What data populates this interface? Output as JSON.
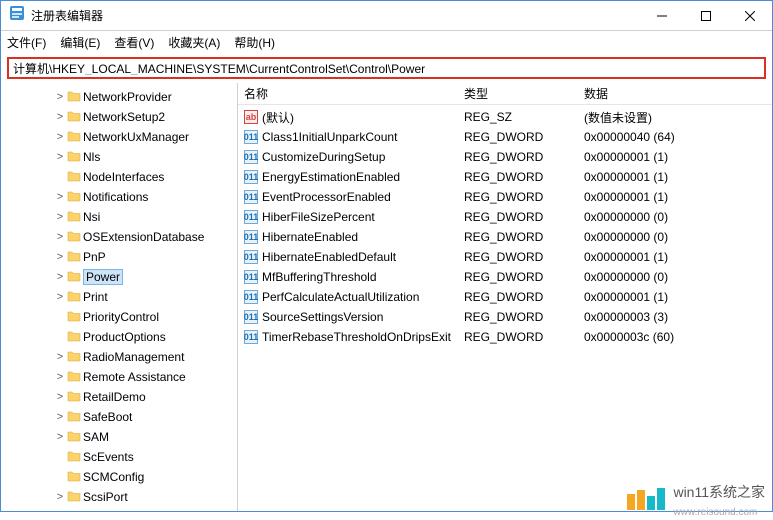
{
  "window": {
    "title": "注册表编辑器"
  },
  "menu": {
    "file": "文件(F)",
    "edit": "编辑(E)",
    "view": "查看(V)",
    "fav": "收藏夹(A)",
    "help": "帮助(H)"
  },
  "address": "计算机\\HKEY_LOCAL_MACHINE\\SYSTEM\\CurrentControlSet\\Control\\Power",
  "tree": [
    {
      "indent": 3,
      "tw": ">",
      "cv": "",
      "label": "NetworkProvider"
    },
    {
      "indent": 3,
      "tw": ">",
      "cv": "",
      "label": "NetworkSetup2"
    },
    {
      "indent": 3,
      "tw": ">",
      "cv": "",
      "label": "NetworkUxManager"
    },
    {
      "indent": 3,
      "tw": ">",
      "cv": "",
      "label": "Nls"
    },
    {
      "indent": 3,
      "tw": "",
      "cv": "",
      "label": "NodeInterfaces"
    },
    {
      "indent": 3,
      "tw": ">",
      "cv": "",
      "label": "Notifications"
    },
    {
      "indent": 3,
      "tw": ">",
      "cv": "",
      "label": "Nsi"
    },
    {
      "indent": 3,
      "tw": ">",
      "cv": "",
      "label": "OSExtensionDatabase"
    },
    {
      "indent": 3,
      "tw": ">",
      "cv": "",
      "label": "PnP"
    },
    {
      "indent": 3,
      "tw": ">",
      "cv": "",
      "label": "Power",
      "selected": true
    },
    {
      "indent": 3,
      "tw": ">",
      "cv": "",
      "label": "Print"
    },
    {
      "indent": 3,
      "tw": "",
      "cv": "",
      "label": "PriorityControl"
    },
    {
      "indent": 3,
      "tw": "",
      "cv": "",
      "label": "ProductOptions"
    },
    {
      "indent": 3,
      "tw": ">",
      "cv": "",
      "label": "RadioManagement"
    },
    {
      "indent": 3,
      "tw": ">",
      "cv": "",
      "label": "Remote Assistance"
    },
    {
      "indent": 3,
      "tw": ">",
      "cv": "",
      "label": "RetailDemo"
    },
    {
      "indent": 3,
      "tw": ">",
      "cv": "",
      "label": "SafeBoot"
    },
    {
      "indent": 3,
      "tw": ">",
      "cv": "",
      "label": "SAM"
    },
    {
      "indent": 3,
      "tw": "",
      "cv": "",
      "label": "ScEvents"
    },
    {
      "indent": 3,
      "tw": "",
      "cv": "",
      "label": "SCMConfig"
    },
    {
      "indent": 3,
      "tw": ">",
      "cv": "",
      "label": "ScsiPort"
    }
  ],
  "columns": {
    "name": "名称",
    "type": "类型",
    "data": "数据"
  },
  "rows": [
    {
      "ico": "ab",
      "name": "(默认)",
      "type": "REG_SZ",
      "data": "(数值未设置)"
    },
    {
      "ico": "num",
      "name": "Class1InitialUnparkCount",
      "type": "REG_DWORD",
      "data": "0x00000040 (64)"
    },
    {
      "ico": "num",
      "name": "CustomizeDuringSetup",
      "type": "REG_DWORD",
      "data": "0x00000001 (1)"
    },
    {
      "ico": "num",
      "name": "EnergyEstimationEnabled",
      "type": "REG_DWORD",
      "data": "0x00000001 (1)"
    },
    {
      "ico": "num",
      "name": "EventProcessorEnabled",
      "type": "REG_DWORD",
      "data": "0x00000001 (1)"
    },
    {
      "ico": "num",
      "name": "HiberFileSizePercent",
      "type": "REG_DWORD",
      "data": "0x00000000 (0)"
    },
    {
      "ico": "num",
      "name": "HibernateEnabled",
      "type": "REG_DWORD",
      "data": "0x00000000 (0)"
    },
    {
      "ico": "num",
      "name": "HibernateEnabledDefault",
      "type": "REG_DWORD",
      "data": "0x00000001 (1)"
    },
    {
      "ico": "num",
      "name": "MfBufferingThreshold",
      "type": "REG_DWORD",
      "data": "0x00000000 (0)"
    },
    {
      "ico": "num",
      "name": "PerfCalculateActualUtilization",
      "type": "REG_DWORD",
      "data": "0x00000001 (1)"
    },
    {
      "ico": "num",
      "name": "SourceSettingsVersion",
      "type": "REG_DWORD",
      "data": "0x00000003 (3)"
    },
    {
      "ico": "num",
      "name": "TimerRebaseThresholdOnDripsExit",
      "type": "REG_DWORD",
      "data": "0x0000003c (60)"
    }
  ],
  "watermark": {
    "text": "win11系统之家",
    "url": "www.reisound.com"
  }
}
